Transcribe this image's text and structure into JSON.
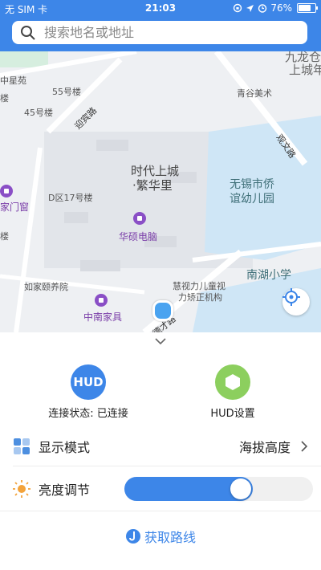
{
  "status_bar": {
    "carrier": "无 SIM 卡",
    "time": "21:03",
    "battery_percent": "76%",
    "battery_level": 0.76,
    "icons": [
      "orientation-lock-icon",
      "location-arrow-icon",
      "alarm-icon",
      "battery-icon"
    ]
  },
  "search": {
    "placeholder": "搜索地名或地址",
    "icon": "search-icon"
  },
  "map": {
    "labels": {
      "zhongxingyuan": "中星苑",
      "building55": "55号楼",
      "building45": "45号楼",
      "lou": "楼",
      "yingbin_road": "迎宾路",
      "qingfen": "青谷美术",
      "jiulonggang": "九龙仓",
      "shangchengcity": "上城年",
      "times_city": "时代上城",
      "fanhuali": "·繁华里",
      "d17": "D区17号楼",
      "jiamenchuang": "家门窗",
      "huashuo": "华硕电脑",
      "wuxi_kindergarten_1": "无锡市侨",
      "wuxi_kindergarten_2": "谊幼儿园",
      "nanhu_school": "南湖小学",
      "rujia": "如家颐养院",
      "zhongnan": "中南家具",
      "huishi_1": "慧视力儿童视",
      "huishi_2": "力矫正机构",
      "dexing_road": "德才路",
      "guanwen_road": "观文路",
      "lou2": "楼"
    },
    "colors": {
      "land": "#eef0f3",
      "block": "#e0e3e8",
      "road": "#ffffff",
      "water": "#cfe6f6",
      "green": "#d6eedf",
      "poi": "#8a4fc6"
    }
  },
  "panel": {
    "hud_connection": {
      "badge": "HUD",
      "label": "连接状态: 已连接",
      "color": "#3d86e8"
    },
    "hud_settings": {
      "label": "HUD设置",
      "color": "#8ccf5e"
    },
    "display_mode": {
      "title": "显示模式",
      "value": "海拔高度",
      "icon": "grid-icon"
    },
    "brightness": {
      "title": "亮度调节",
      "icon": "sun-icon",
      "level": 0.68
    },
    "route_button": {
      "label": "获取路线",
      "icon": "route-icon"
    }
  }
}
